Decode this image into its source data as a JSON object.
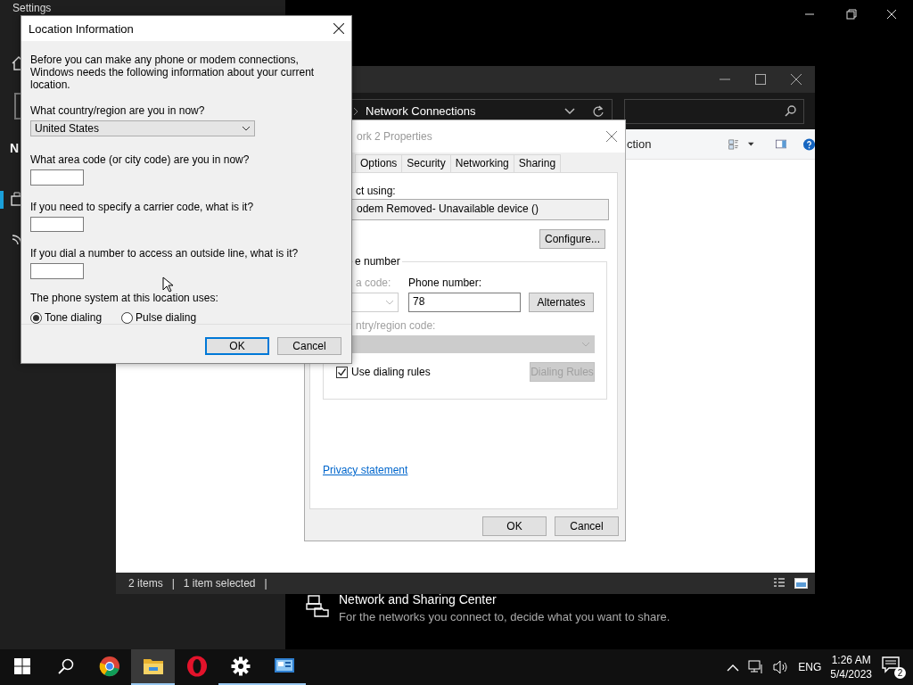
{
  "settings_window": {
    "title": "Settings",
    "sidebar_heading_fragment": "N",
    "sharing_center": {
      "title": "Network and Sharing Center",
      "description": "For the networks you connect to, decide what you want to share."
    }
  },
  "explorer": {
    "address": "Network Connections",
    "toolbar_fragment": "ction",
    "status": [
      "2 items",
      "1 item selected"
    ],
    "status_separator": "|"
  },
  "properties_dialog": {
    "title": "ork 2 Properties",
    "tabs": [
      {
        "label": "Options",
        "selected": false
      },
      {
        "label": "Security",
        "selected": false
      },
      {
        "label": "Networking",
        "selected": false
      },
      {
        "label": "Sharing",
        "selected": false
      }
    ],
    "connect_using_label": "ct using:",
    "device": "odem Removed- Unavailable device ()",
    "configure_button": "Configure...",
    "group_legend": "e number",
    "area_code_label": "a code:",
    "area_code_disabled": true,
    "phone_label": "Phone number:",
    "phone_value": "78",
    "alternates_button": "Alternates",
    "country_code_label": "ntry/region code:",
    "country_code_disabled": true,
    "use_dialing_rules": {
      "label": "Use dialing rules",
      "checked": true
    },
    "dialing_rules_button": {
      "label": "Dialing Rules",
      "disabled": true
    },
    "privacy_link": "Privacy statement",
    "buttons": [
      "OK",
      "Cancel"
    ]
  },
  "location_dialog": {
    "title": "Location Information",
    "intro": "Before you can make any phone or modem connections, Windows needs the following information about your current location.",
    "country_label": "What country/region are you in now?",
    "country_value": "United States",
    "area_code_label": "What area code (or city code) are you in now?",
    "carrier_label": "If you need to specify a carrier code, what is it?",
    "outside_line_label": "If you dial a number to access an outside line, what is it?",
    "phone_system_label": "The phone system at this location uses:",
    "dialing_options": [
      {
        "label": "Tone dialing",
        "selected": true
      },
      {
        "label": "Pulse dialing",
        "selected": false
      }
    ],
    "buttons": [
      {
        "label": "OK",
        "default": true
      },
      {
        "label": "Cancel",
        "default": false
      }
    ]
  },
  "taskbar": {
    "apps": [
      {
        "kind": "chrome",
        "running": false,
        "selected": false
      },
      {
        "kind": "explorer",
        "running": true,
        "selected": true
      },
      {
        "kind": "opera",
        "running": false,
        "selected": false
      },
      {
        "kind": "settings",
        "running": true,
        "selected": false
      },
      {
        "kind": "control-panel",
        "running": true,
        "selected": false
      }
    ],
    "language": "ENG",
    "time": "1:26 AM",
    "date": "5/4/2023",
    "notification_count": "2"
  }
}
